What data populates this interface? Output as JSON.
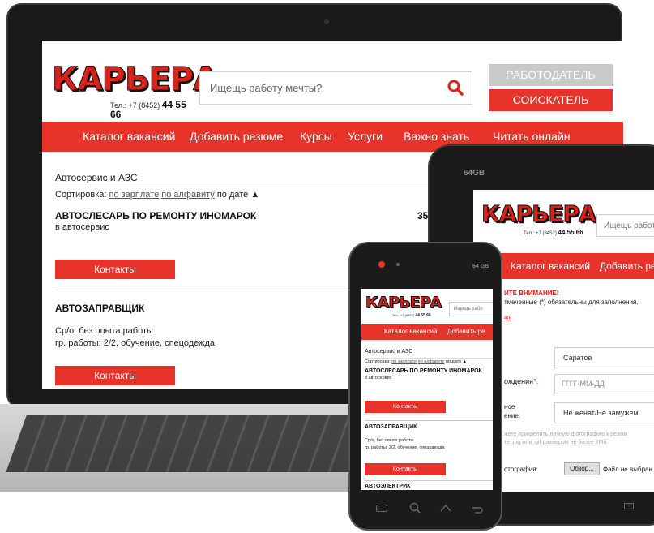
{
  "brand": {
    "logo_text": "КАРЬЕРА",
    "phone_label": "Тел.: +7 (8452)",
    "phone_number": "44 55 66"
  },
  "header": {
    "search_placeholder": "Ищещь работу мечты?",
    "search_placeholder_short": "Ищещь работу",
    "search_placeholder_phone": "Ищещь рабо",
    "employer_button": "РАБОТОДАТЕЛЬ",
    "seeker_button": "СОИСКАТЕЛЬ"
  },
  "nav": {
    "items": [
      "Каталог вакансий",
      "Добавить резюме",
      "Курсы",
      "Услуги",
      "Важно знать",
      "Читать онлайн"
    ],
    "tablet_items": [
      "Каталог вакансий",
      "Добавить рез"
    ],
    "phone_items": [
      "Каталог вакансий",
      "Добавить ре"
    ]
  },
  "listing": {
    "category": "Автосервис и АЗС",
    "sort_label": "Сортировка:",
    "sort_salary": "по зарплате",
    "sort_alpha": "по алфавиту",
    "sort_date": "по дате ▲",
    "sort_date_phone": "по дате ▲",
    "jobs": [
      {
        "title": "АВТОСЛЕСАРЬ ПО РЕМОНТУ ИНОМАРОК",
        "subtitle": "в автосервис",
        "salary": "35",
        "button": "Контакты"
      },
      {
        "title": "АВТОЗАПРАВЩИК",
        "line1": "Ср/о, без опыта работы",
        "line2": "гр. работы: 2/2, обучение, спецодежда",
        "button": "Контакты"
      },
      {
        "title": "АВТОЭЛЕКТРИК"
      }
    ]
  },
  "tablet": {
    "label": "64GB",
    "notice_title": "ИТЕ ВНИМАНИЕ!",
    "notice_text": "тмеченные (*) обязательны для заполнения.",
    "link": "ать",
    "city_value": "Саратов",
    "birth_label": "ождения",
    "birth_star": "*:",
    "birth_placeholder": "ГГГГ-ММ-ДД",
    "marital_label_1": "ное",
    "marital_label_2": "ение:",
    "marital_value": "Не женат/Не замужем",
    "photo_hint_1": "жете прикрепить личную фотографию к резюм",
    "photo_hint_2": "те .jpg или .gif размером не более 2Мб",
    "photo_label": "отография:",
    "browse_button": "Обзор...",
    "file_status": "Файл не выбран."
  },
  "phone": {
    "label": "64 GB"
  },
  "colors": {
    "brand_red": "#e8332a",
    "employer_gray": "#c9c9c9",
    "device_black": "#1b1b1b"
  }
}
